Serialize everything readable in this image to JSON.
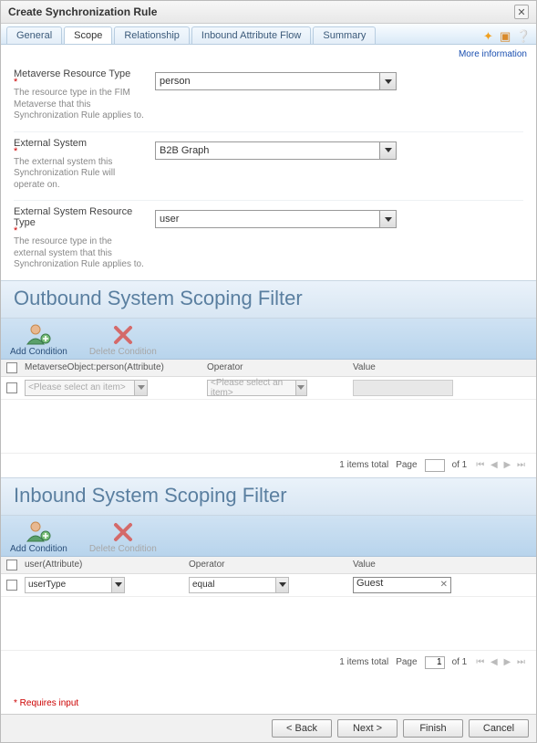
{
  "title": "Create Synchronization Rule",
  "tabs": [
    "General",
    "Scope",
    "Relationship",
    "Inbound Attribute Flow",
    "Summary"
  ],
  "active_tab": 1,
  "more_info": "More information",
  "fields": {
    "mv": {
      "label": "Metaverse Resource Type",
      "desc": "The resource type in the FIM Metaverse that this Synchronization Rule applies to.",
      "value": "person"
    },
    "ext": {
      "label": "External System",
      "desc": "The external system this Synchronization Rule will operate on.",
      "value": "B2B Graph"
    },
    "extres": {
      "label": "External System Resource Type",
      "desc": "The resource type in the external system that this Synchronization Rule applies to.",
      "value": "user"
    }
  },
  "outbound": {
    "title": "Outbound System Scoping Filter",
    "add": "Add Condition",
    "delete": "Delete Condition",
    "headers": {
      "attr": "MetaverseObject:person(Attribute)",
      "op": "Operator",
      "val": "Value"
    },
    "row_placeholder": "<Please select an item>",
    "items_total": "1 items total",
    "page_label": "Page",
    "of_label": "of 1"
  },
  "inbound": {
    "title": "Inbound System Scoping Filter",
    "add": "Add Condition",
    "delete": "Delete Condition",
    "headers": {
      "attr": "user(Attribute)",
      "op": "Operator",
      "val": "Value"
    },
    "row": {
      "attr": "userType",
      "op": "equal",
      "val": "Guest"
    },
    "items_total": "1 items total",
    "page_label": "Page",
    "page_value": "1",
    "of_label": "of 1"
  },
  "requires_note": "* Requires input",
  "buttons": {
    "back": "< Back",
    "next": "Next >",
    "finish": "Finish",
    "cancel": "Cancel"
  }
}
